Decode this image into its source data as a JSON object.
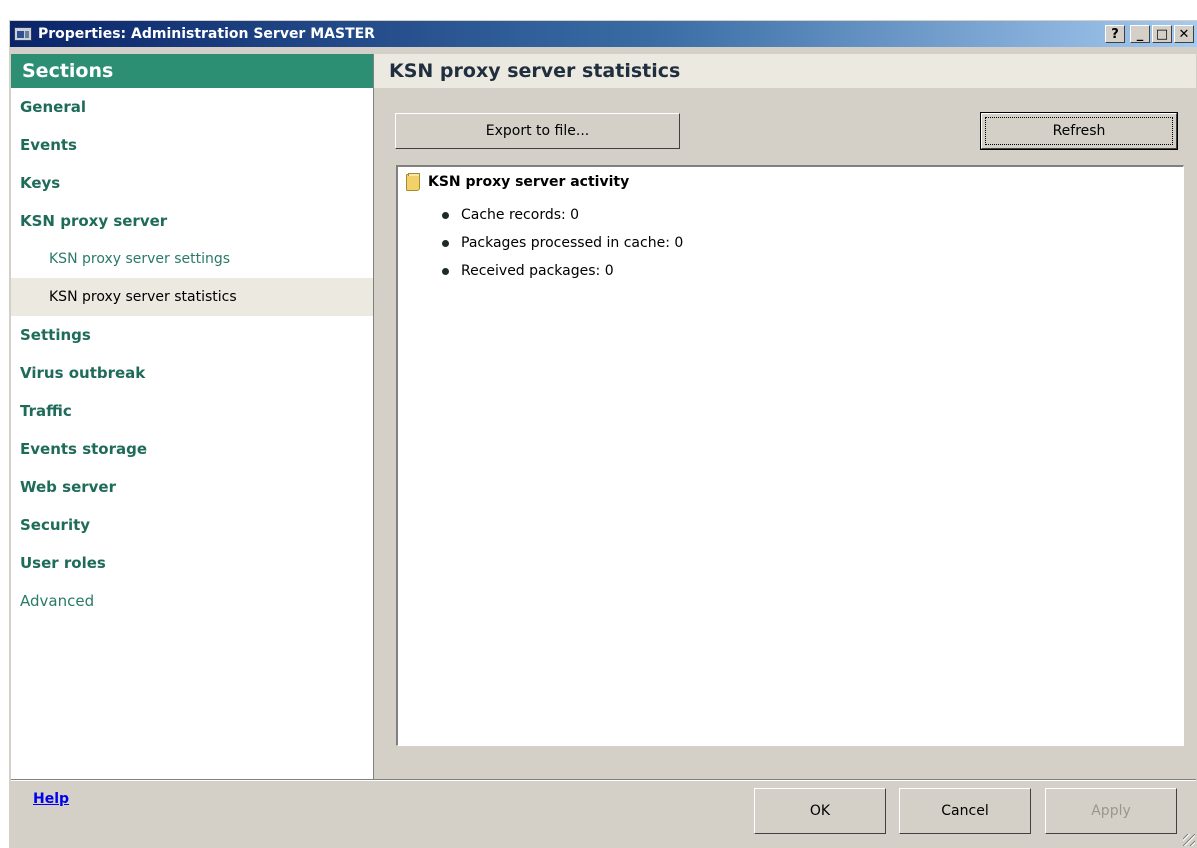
{
  "window": {
    "title": "Properties: Administration Server MASTER",
    "buttons": {
      "help": "?",
      "minimize": "_",
      "maximize": "□",
      "close": "✕"
    }
  },
  "sidebar": {
    "header": "Sections",
    "items": [
      {
        "label": "General"
      },
      {
        "label": "Events"
      },
      {
        "label": "Keys"
      },
      {
        "label": "KSN proxy server"
      },
      {
        "label": "KSN proxy server settings"
      },
      {
        "label": "KSN proxy server statistics"
      },
      {
        "label": "Settings"
      },
      {
        "label": "Virus outbreak"
      },
      {
        "label": "Traffic"
      },
      {
        "label": "Events storage"
      },
      {
        "label": "Web server"
      },
      {
        "label": "Security"
      },
      {
        "label": "User roles"
      },
      {
        "label": "Advanced"
      }
    ],
    "selected": "KSN proxy server statistics"
  },
  "main": {
    "title": "KSN proxy server statistics",
    "export_label": "Export to file...",
    "refresh_label": "Refresh",
    "group": {
      "title": "KSN proxy server activity",
      "icon": "folder-icon",
      "stats": [
        {
          "label": "Cache records: 0"
        },
        {
          "label": "Packages processed in cache: 0"
        },
        {
          "label": "Received packages: 0"
        }
      ]
    }
  },
  "footer": {
    "help_label": "Help",
    "ok_label": "OK",
    "cancel_label": "Cancel",
    "apply_label": "Apply"
  },
  "colors": {
    "accent": "#2c8f74",
    "nav_text": "#1f6b5a",
    "selected_bg": "#ece9e1",
    "dialog_bg": "#d4d0c8"
  }
}
